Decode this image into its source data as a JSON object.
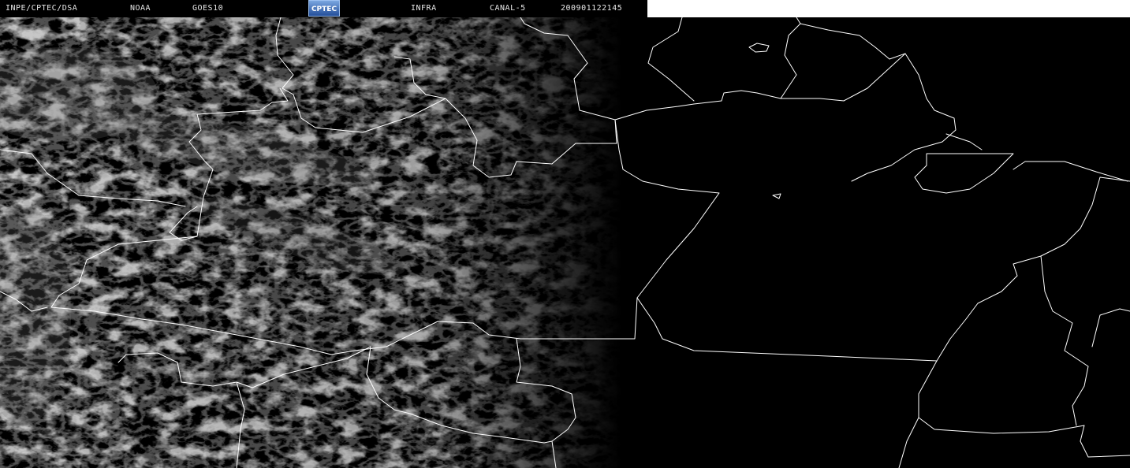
{
  "header": {
    "source": "INPE/CPTEC/DSA",
    "agency": "NOAA",
    "satellite": "GOES10",
    "logo_text": "CPTEC",
    "type": "INFRA",
    "channel": "CANAL-5",
    "timestamp": "200901122145"
  },
  "colors": {
    "background": "#000000",
    "borders": "#ffffff",
    "clouds": "#8a8a8a"
  }
}
